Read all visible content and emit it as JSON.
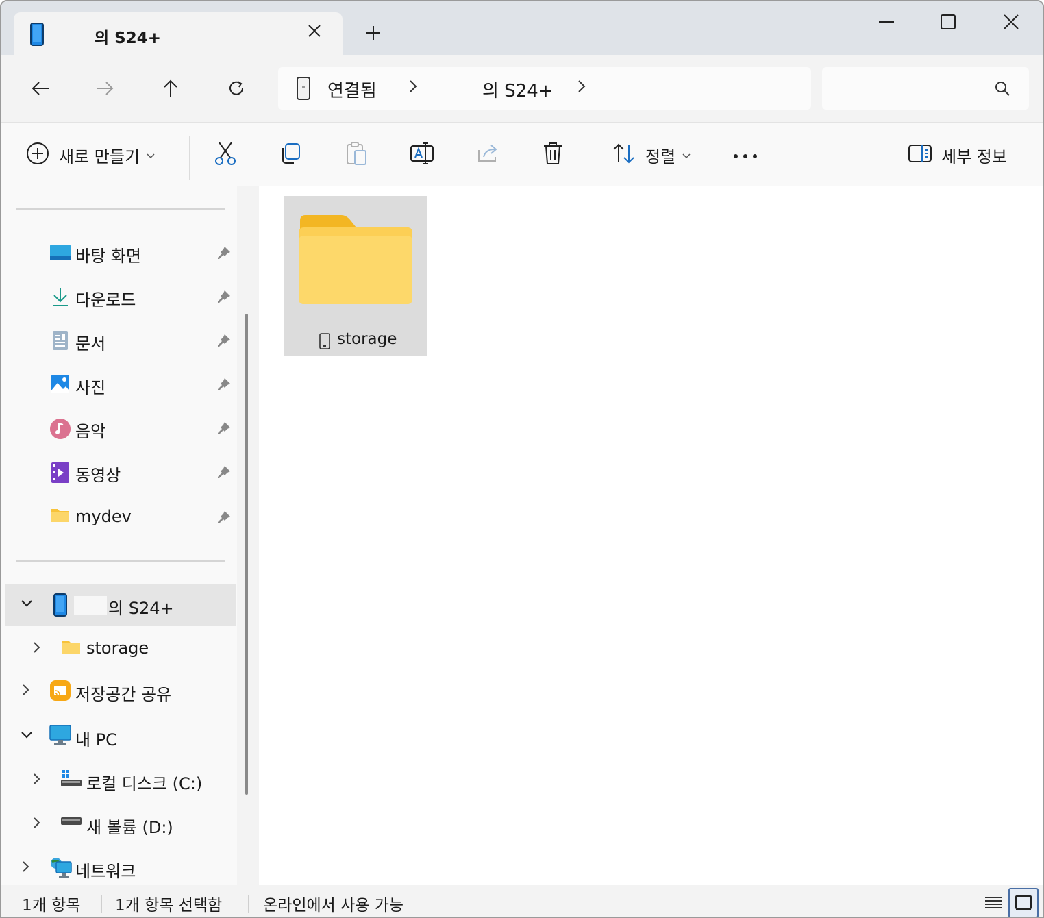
{
  "tab": {
    "title": "의 S24+",
    "close_icon": "close-icon"
  },
  "window_controls": {
    "minimize": "minimize-icon",
    "maximize": "maximize-icon",
    "close": "close-icon"
  },
  "address": {
    "crumbs": [
      {
        "label": "연결됨"
      },
      {
        "label": "의 S24+"
      }
    ]
  },
  "toolbar": {
    "new_label": "새로 만들기",
    "sort_label": "정렬",
    "details_label": "세부 정보",
    "more_icon": "more-icon"
  },
  "sidebar": {
    "quick_access": [
      {
        "label": "바탕 화면"
      },
      {
        "label": "다운로드"
      },
      {
        "label": "문서"
      },
      {
        "label": "사진"
      },
      {
        "label": "음악"
      },
      {
        "label": "동영상"
      },
      {
        "label": "mydev"
      }
    ],
    "device": {
      "label": "의 S24+"
    },
    "device_children": [
      {
        "label": "storage"
      }
    ],
    "share": {
      "label": "저장공간 공유"
    },
    "pc": {
      "label": "내 PC"
    },
    "pc_children": [
      {
        "label": "로컬 디스크 (C:)"
      },
      {
        "label": "새 볼륨 (D:)"
      }
    ],
    "network": {
      "label": "네트워크"
    }
  },
  "content": {
    "items": [
      {
        "label": "storage"
      }
    ]
  },
  "status": {
    "count": "1개 항목",
    "selected": "1개 항목 선택함",
    "availability": "온라인에서 사용 가능"
  },
  "colors": {
    "accent": "#0067c0",
    "folder": "#f8c33a",
    "selection": "#e5e5e5"
  }
}
